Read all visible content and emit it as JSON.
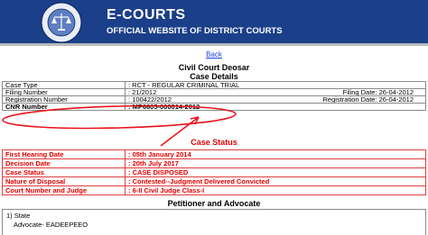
{
  "header": {
    "title": "E-COURTS",
    "subtitle": "OFFICIAL WEBSITE OF DISTRICT COURTS",
    "bg_color": "#1b3f88",
    "logo": "emblem-icon"
  },
  "nav": {
    "back_label": "Back"
  },
  "court": {
    "name": "Civil Court Deosar"
  },
  "case_details": {
    "heading": "Case Details",
    "case_type_label": "Case Type",
    "case_type_value": ": RCT - REGULAR CRIMINAL TRIAL",
    "filing_number_label": "Filing Number",
    "filing_number_value": ": 21/2012",
    "filing_date": "Filing Date: 26-04-2012",
    "registration_number_label": "Registration Number",
    "registration_number_value": ": 100422/2012",
    "registration_date": "Registration Date: 26-04-2012",
    "cnr_label": "CNR Number",
    "cnr_value": ": MP6605-000014-2012"
  },
  "case_status": {
    "heading": "Case Status",
    "color": "#e00000",
    "rows": [
      {
        "label": "First Hearing Date",
        "value": ": 05th January 2014"
      },
      {
        "label": "Decision Date",
        "value": ": 20th July 2017"
      },
      {
        "label": "Case Status",
        "value": ": CASE DISPOSED"
      },
      {
        "label": "Nature of Disposal",
        "value": ": Contested--Judgment Delivered Convicted"
      },
      {
        "label": "Court Number and Judge",
        "value": ": 6-II Civil Judge Class-I"
      }
    ]
  },
  "petitioner": {
    "heading": "Petitioner and Advocate",
    "line1": "1) State",
    "line2": "Advocate- EADEEPEEO"
  },
  "annotation": {
    "color": "#e8141a"
  }
}
